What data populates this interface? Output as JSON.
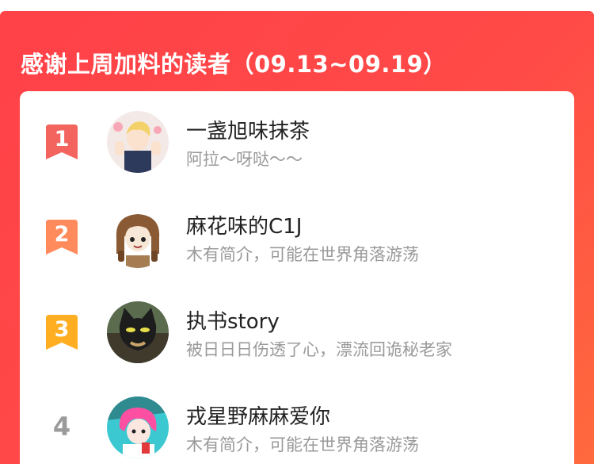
{
  "header": {
    "title": "感谢上周加料的读者（09.13~09.19）"
  },
  "colors": {
    "header_red": "#ff4148",
    "header_orange": "#ff6a3d",
    "rank1": "#f4645e",
    "rank2": "#ff8a5c",
    "rank3": "#ffae21",
    "rank_plain": "#9a9a9a",
    "desc_gray": "#9a9a9a"
  },
  "readers": [
    {
      "rank": "1",
      "name": "一盏旭味抹茶",
      "desc": "阿拉～呀哒～～",
      "avatar": "anime-boy-avatar"
    },
    {
      "rank": "2",
      "name": "麻花味的C1J",
      "desc": "木有简介，可能在世界角落游荡",
      "avatar": "braided-girl-avatar"
    },
    {
      "rank": "3",
      "name": "执书story",
      "desc": "被日日日伤透了心，漂流回诡秘老家",
      "avatar": "cat-mask-avatar"
    },
    {
      "rank": "4",
      "name": "戎星野麻麻爱你",
      "desc": "木有简介，可能在世界角落游荡",
      "avatar": "pink-hair-avatar"
    }
  ]
}
